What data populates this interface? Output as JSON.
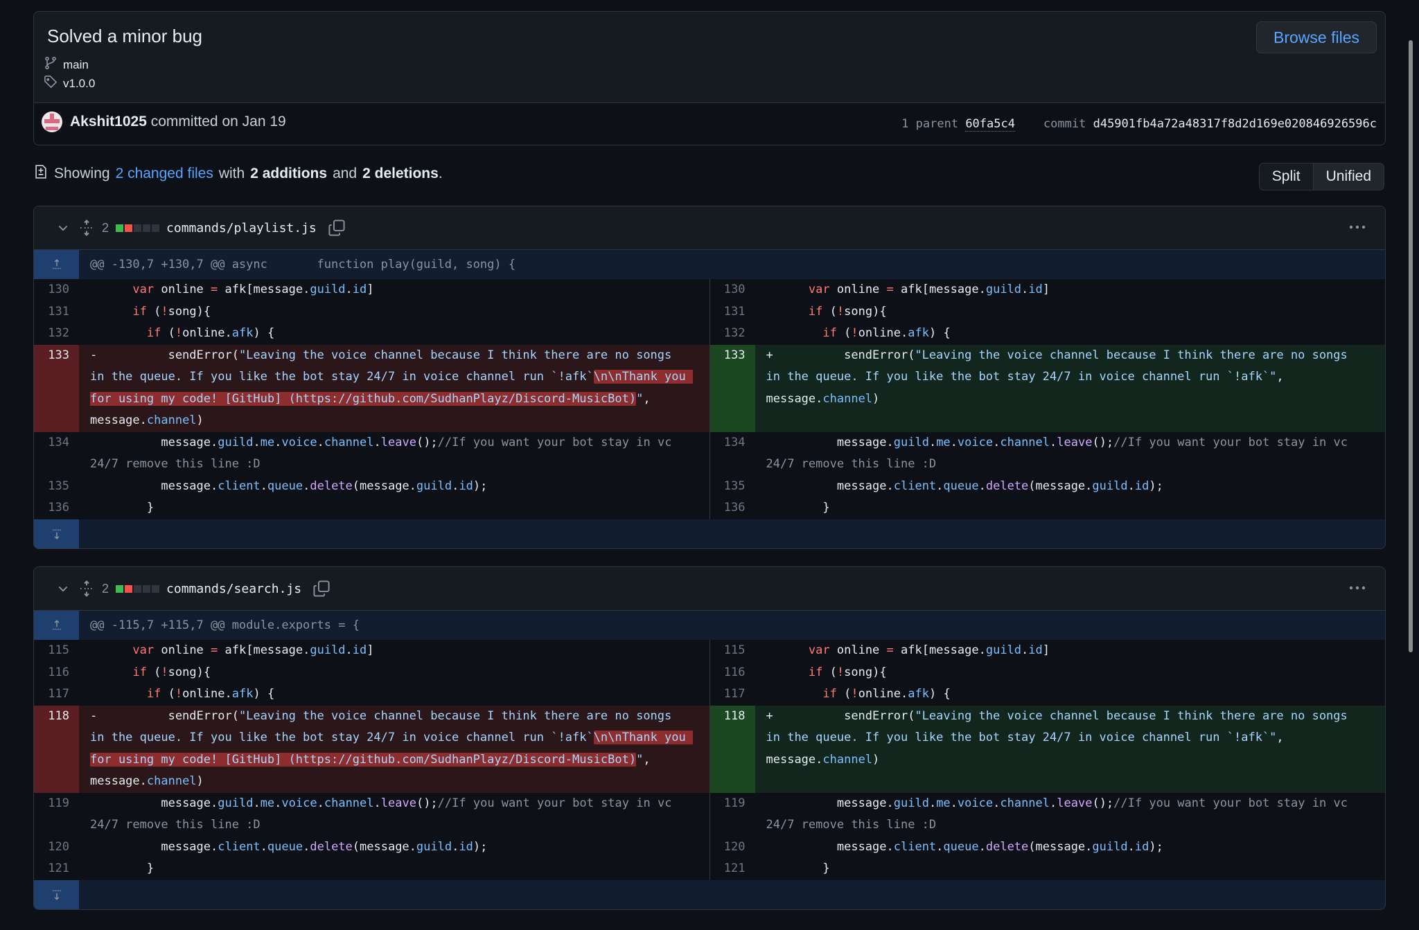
{
  "commit": {
    "title": "Solved a minor bug",
    "browse_label": "Browse files",
    "branch": "main",
    "tag": "v1.0.0",
    "author": "Akshit1025",
    "committed_text": "committed on Jan 19",
    "parent_label": "1 parent",
    "parent_sha": "60fa5c4",
    "commit_label": "commit",
    "commit_sha": "d45901fb4a72a48317f8d2d169e020846926596c"
  },
  "summary": {
    "prefix": "Showing",
    "changed_files": "2 changed files",
    "with": "with",
    "additions": "2 additions",
    "and": "and",
    "deletions": "2 deletions",
    "suffix": "."
  },
  "view_toggle": {
    "split": "Split",
    "unified": "Unified",
    "selected": "Split"
  },
  "colors": {
    "accent": "#58a6ff",
    "addition": "#3fb950",
    "deletion": "#f85149"
  },
  "files": [
    {
      "path": "commands/playlist.js",
      "changes": "2",
      "diffstat": [
        "add",
        "del",
        "neutral",
        "neutral",
        "neutral"
      ],
      "hunk": "@@ -130,7 +130,7 @@ async       function play(guild, song) {",
      "left": [
        {
          "n": "130",
          "t": "ctx",
          "html": "      <span class='k'>var</span> online <span class='k'>=</span> afk[message.<span class='p'>guild</span>.<span class='p'>id</span>]"
        },
        {
          "n": "131",
          "t": "ctx",
          "html": "      <span class='k'>if</span> (<span class='k'>!</span>song){"
        },
        {
          "n": "132",
          "t": "ctx",
          "html": "        <span class='k'>if</span> (<span class='k'>!</span>online.<span class='p'>afk</span>) {"
        },
        {
          "n": "133",
          "t": "del",
          "html": "-          sendError(<span class='s'>\"Leaving the voice channel because I think there are no songs in the queue. If you like the bot stay 24/7 in voice channel run `!afk`<span class='hl'>\\n\\nThank you for using my code! [GitHub] (https://github.com/SudhanPlayz/Discord-MusicBot)</span>\"</span>, message.<span class='p'>channel</span>)"
        },
        {
          "n": "134",
          "t": "ctx",
          "html": "          message.<span class='p'>guild</span>.<span class='p'>me</span>.<span class='p'>voice</span>.<span class='p'>channel</span>.<span class='f'>leave</span>();<span class='c'>//If you want your bot stay in vc 24/7 remove this line :D</span>"
        },
        {
          "n": "135",
          "t": "ctx",
          "html": "          message.<span class='p'>client</span>.<span class='p'>queue</span>.<span class='f'>delete</span>(message.<span class='p'>guild</span>.<span class='p'>id</span>);"
        },
        {
          "n": "136",
          "t": "ctx",
          "html": "        }"
        }
      ],
      "right": [
        {
          "n": "130",
          "t": "ctx",
          "html": "      <span class='k'>var</span> online <span class='k'>=</span> afk[message.<span class='p'>guild</span>.<span class='p'>id</span>]"
        },
        {
          "n": "131",
          "t": "ctx",
          "html": "      <span class='k'>if</span> (<span class='k'>!</span>song){"
        },
        {
          "n": "132",
          "t": "ctx",
          "html": "        <span class='k'>if</span> (<span class='k'>!</span>online.<span class='p'>afk</span>) {"
        },
        {
          "n": "133",
          "t": "add",
          "html": "+          sendError(<span class='s'>\"Leaving the voice channel because I think there are no songs in the queue. If you like the bot stay 24/7 in voice channel run `!afk`\"</span>, message.<span class='p'>channel</span>)\n "
        },
        {
          "n": "134",
          "t": "ctx",
          "html": "          message.<span class='p'>guild</span>.<span class='p'>me</span>.<span class='p'>voice</span>.<span class='p'>channel</span>.<span class='f'>leave</span>();<span class='c'>//If you want your bot stay in vc 24/7 remove this line :D</span>"
        },
        {
          "n": "135",
          "t": "ctx",
          "html": "          message.<span class='p'>client</span>.<span class='p'>queue</span>.<span class='f'>delete</span>(message.<span class='p'>guild</span>.<span class='p'>id</span>);"
        },
        {
          "n": "136",
          "t": "ctx",
          "html": "        }"
        }
      ]
    },
    {
      "path": "commands/search.js",
      "changes": "2",
      "diffstat": [
        "add",
        "del",
        "neutral",
        "neutral",
        "neutral"
      ],
      "hunk": "@@ -115,7 +115,7 @@ module.exports = {",
      "left": [
        {
          "n": "115",
          "t": "ctx",
          "html": "      <span class='k'>var</span> online <span class='k'>=</span> afk[message.<span class='p'>guild</span>.<span class='p'>id</span>]"
        },
        {
          "n": "116",
          "t": "ctx",
          "html": "      <span class='k'>if</span> (<span class='k'>!</span>song){"
        },
        {
          "n": "117",
          "t": "ctx",
          "html": "        <span class='k'>if</span> (<span class='k'>!</span>online.<span class='p'>afk</span>) {"
        },
        {
          "n": "118",
          "t": "del",
          "html": "-          sendError(<span class='s'>\"Leaving the voice channel because I think there are no songs in the queue. If you like the bot stay 24/7 in voice channel run `!afk`<span class='hl'>\\n\\nThank you for using my code! [GitHub] (https://github.com/SudhanPlayz/Discord-MusicBot)</span>\"</span>, message.<span class='p'>channel</span>)"
        },
        {
          "n": "119",
          "t": "ctx",
          "html": "          message.<span class='p'>guild</span>.<span class='p'>me</span>.<span class='p'>voice</span>.<span class='p'>channel</span>.<span class='f'>leave</span>();<span class='c'>//If you want your bot stay in vc 24/7 remove this line :D</span>"
        },
        {
          "n": "120",
          "t": "ctx",
          "html": "          message.<span class='p'>client</span>.<span class='p'>queue</span>.<span class='f'>delete</span>(message.<span class='p'>guild</span>.<span class='p'>id</span>);"
        },
        {
          "n": "121",
          "t": "ctx",
          "html": "        }"
        }
      ],
      "right": [
        {
          "n": "115",
          "t": "ctx",
          "html": "      <span class='k'>var</span> online <span class='k'>=</span> afk[message.<span class='p'>guild</span>.<span class='p'>id</span>]"
        },
        {
          "n": "116",
          "t": "ctx",
          "html": "      <span class='k'>if</span> (<span class='k'>!</span>song){"
        },
        {
          "n": "117",
          "t": "ctx",
          "html": "        <span class='k'>if</span> (<span class='k'>!</span>online.<span class='p'>afk</span>) {"
        },
        {
          "n": "118",
          "t": "add",
          "html": "+          sendError(<span class='s'>\"Leaving the voice channel because I think there are no songs in the queue. If you like the bot stay 24/7 in voice channel run `!afk`\"</span>, message.<span class='p'>channel</span>)\n "
        },
        {
          "n": "119",
          "t": "ctx",
          "html": "          message.<span class='p'>guild</span>.<span class='p'>me</span>.<span class='p'>voice</span>.<span class='p'>channel</span>.<span class='f'>leave</span>();<span class='c'>//If you want your bot stay in vc 24/7 remove this line :D</span>"
        },
        {
          "n": "120",
          "t": "ctx",
          "html": "          message.<span class='p'>client</span>.<span class='p'>queue</span>.<span class='f'>delete</span>(message.<span class='p'>guild</span>.<span class='p'>id</span>);"
        },
        {
          "n": "121",
          "t": "ctx",
          "html": "        }"
        }
      ]
    }
  ]
}
